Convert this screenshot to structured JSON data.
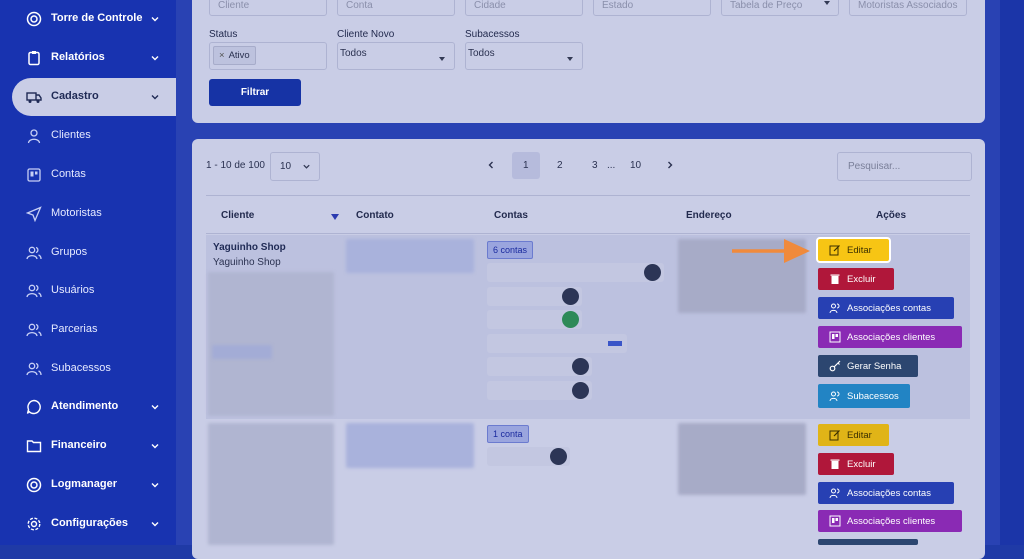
{
  "sidebar": {
    "items": [
      {
        "label": "Torre de Controle",
        "icon": "target-icon"
      },
      {
        "label": "Relatórios",
        "icon": "clipboard-icon"
      },
      {
        "label": "Cadastro",
        "icon": "truck-icon"
      },
      {
        "label": "Clientes",
        "icon": "user-icon"
      },
      {
        "label": "Contas",
        "icon": "board-icon"
      },
      {
        "label": "Motoristas",
        "icon": "send-icon"
      },
      {
        "label": "Grupos",
        "icon": "users-icon"
      },
      {
        "label": "Usuários",
        "icon": "users-icon"
      },
      {
        "label": "Parcerias",
        "icon": "users-icon"
      },
      {
        "label": "Subacessos",
        "icon": "users-icon"
      },
      {
        "label": "Atendimento",
        "icon": "chat-icon"
      },
      {
        "label": "Financeiro",
        "icon": "folder-icon"
      },
      {
        "label": "Logmanager",
        "icon": "target-icon"
      },
      {
        "label": "Configurações",
        "icon": "gear-icon"
      }
    ]
  },
  "filters": {
    "top_placeholders": [
      "Cliente",
      "Conta",
      "Cidade",
      "Estado",
      "Tabela de Preço",
      "Motoristas Associados"
    ],
    "status_label": "Status",
    "status_chip": "Ativo",
    "cliente_novo_label": "Cliente Novo",
    "cliente_novo_value": "Todos",
    "subacessos_label": "Subacessos",
    "subacessos_value": "Todos",
    "filter_button": "Filtrar"
  },
  "table": {
    "range_text": "1 - 10 de 100",
    "page_size": "10",
    "pages": [
      "1",
      "2",
      "3",
      "...",
      "10"
    ],
    "active_page": "1",
    "search_placeholder": "Pesquisar...",
    "headers": [
      "Cliente",
      "Contato",
      "Contas",
      "Endereço",
      "Ações"
    ],
    "rows": [
      {
        "client_name": "Yaguinho Shop",
        "client_sub": "Yaguinho Shop",
        "accounts_badge": "6 contas"
      },
      {
        "client_name": "",
        "client_sub": "",
        "accounts_badge": "1 conta"
      }
    ],
    "actions": {
      "edit": "Editar",
      "delete": "Excluir",
      "assoc_accounts": "Associações contas",
      "assoc_clients": "Associações clientes",
      "gen_password": "Gerar Senha",
      "subaccess": "Subacessos"
    }
  },
  "colors": {
    "highlight": "#f7c514",
    "arrow": "#f08a3c",
    "primary": "#1633a5"
  }
}
